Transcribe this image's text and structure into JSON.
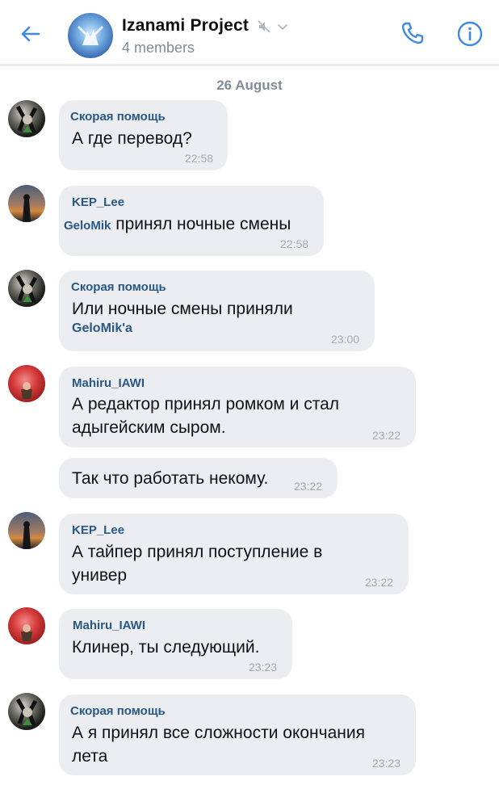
{
  "header": {
    "title": "Izanami Project",
    "subtitle": "4 members",
    "icons": [
      "back-arrow-icon",
      "mute-icon",
      "chevron-down-icon",
      "phone-icon",
      "info-icon"
    ],
    "accent_color": "#3f8ae0"
  },
  "date_separator": "26 August",
  "messages": [
    {
      "sender": "Скорая помощь",
      "text": "А где перевод?",
      "time": "22:58"
    },
    {
      "sender": "KEP_Lee",
      "mention": "GeloMik",
      "text": "принял ночные смены",
      "time": "22:58"
    },
    {
      "sender": "Скорая помощь",
      "text": "Или ночные смены приняли",
      "mention_line": "GeloMik'a",
      "time": "23:00"
    },
    {
      "sender": "Mahiru_IAWI",
      "lines": [
        "А редактор принял ромком и стал",
        "адыгейским сыром."
      ],
      "time": "23:22"
    },
    {
      "text": "Так что работать некому.",
      "time": "23:22"
    },
    {
      "sender": "KEP_Lee",
      "lines": [
        "А тайпер принял поступление в",
        "универ"
      ],
      "time": "23:22"
    },
    {
      "sender": "Mahiru_IAWI",
      "text": "Клинер, ты следующий.",
      "time": "23:23"
    },
    {
      "sender": "Скорая помощь",
      "lines": [
        "А я принял все сложности окончания",
        "лета"
      ],
      "time": "23:23"
    }
  ]
}
